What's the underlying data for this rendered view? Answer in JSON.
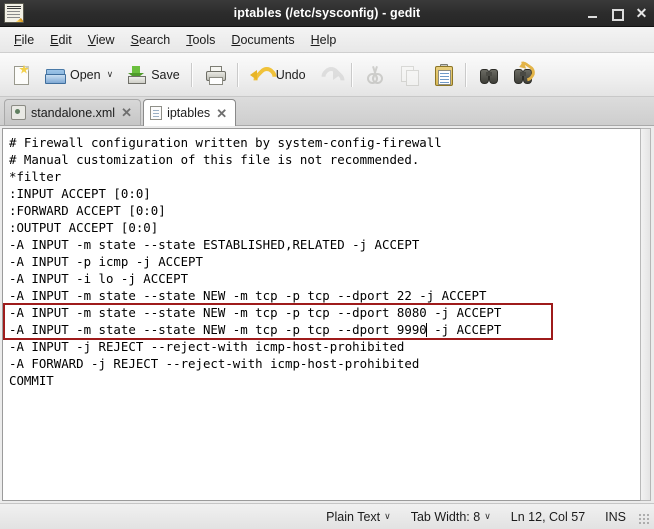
{
  "window": {
    "title": "iptables (/etc/sysconfig) - gedit",
    "icon": "gedit-notepad-pencil-icon",
    "controls": {
      "minimize": "–",
      "maximize": "□",
      "close": "✕"
    }
  },
  "menubar": {
    "items": [
      {
        "label": "File",
        "mnemonic": "F"
      },
      {
        "label": "Edit",
        "mnemonic": "E"
      },
      {
        "label": "View",
        "mnemonic": "V"
      },
      {
        "label": "Search",
        "mnemonic": "S"
      },
      {
        "label": "Tools",
        "mnemonic": "T"
      },
      {
        "label": "Documents",
        "mnemonic": "D"
      },
      {
        "label": "Help",
        "mnemonic": "H"
      }
    ]
  },
  "toolbar": {
    "new_label": "",
    "open_label": "Open",
    "open_dropdown": "∨",
    "save_label": "Save",
    "print_label": "",
    "undo_label": "Undo",
    "redo_label": "",
    "cut_label": "",
    "copy_label": "",
    "paste_label": "",
    "find_label": "",
    "replace_label": ""
  },
  "tabs": [
    {
      "label": "standalone.xml",
      "active": false,
      "close": "✕",
      "icon": "xml-file-icon"
    },
    {
      "label": "iptables",
      "active": true,
      "close": "✕",
      "icon": "text-file-icon"
    }
  ],
  "editor": {
    "content": "# Firewall configuration written by system-config-firewall\n# Manual customization of this file is not recommended.\n*filter\n:INPUT ACCEPT [0:0]\n:FORWARD ACCEPT [0:0]\n:OUTPUT ACCEPT [0:0]\n-A INPUT -m state --state ESTABLISHED,RELATED -j ACCEPT\n-A INPUT -p icmp -j ACCEPT\n-A INPUT -i lo -j ACCEPT\n-A INPUT -m state --state NEW -m tcp -p tcp --dport 22 -j ACCEPT\n-A INPUT -m state --state NEW -m tcp -p tcp --dport 8080 -j ACCEPT\n-A INPUT -m state --state NEW -m tcp -p tcp --dport 9990 -j ACCEPT\n-A INPUT -j REJECT --reject-with icmp-host-prohibited\n-A FORWARD -j REJECT --reject-with icmp-host-prohibited\nCOMMIT",
    "highlight_color": "#9e1b1b",
    "highlighted_lines": [
      11,
      12
    ]
  },
  "statusbar": {
    "language": "Plain Text",
    "language_caret": "∨",
    "tab_width": "Tab Width: 8",
    "tab_width_caret": "∨",
    "cursor_position": "Ln 12, Col 57",
    "insert_mode": "INS"
  }
}
